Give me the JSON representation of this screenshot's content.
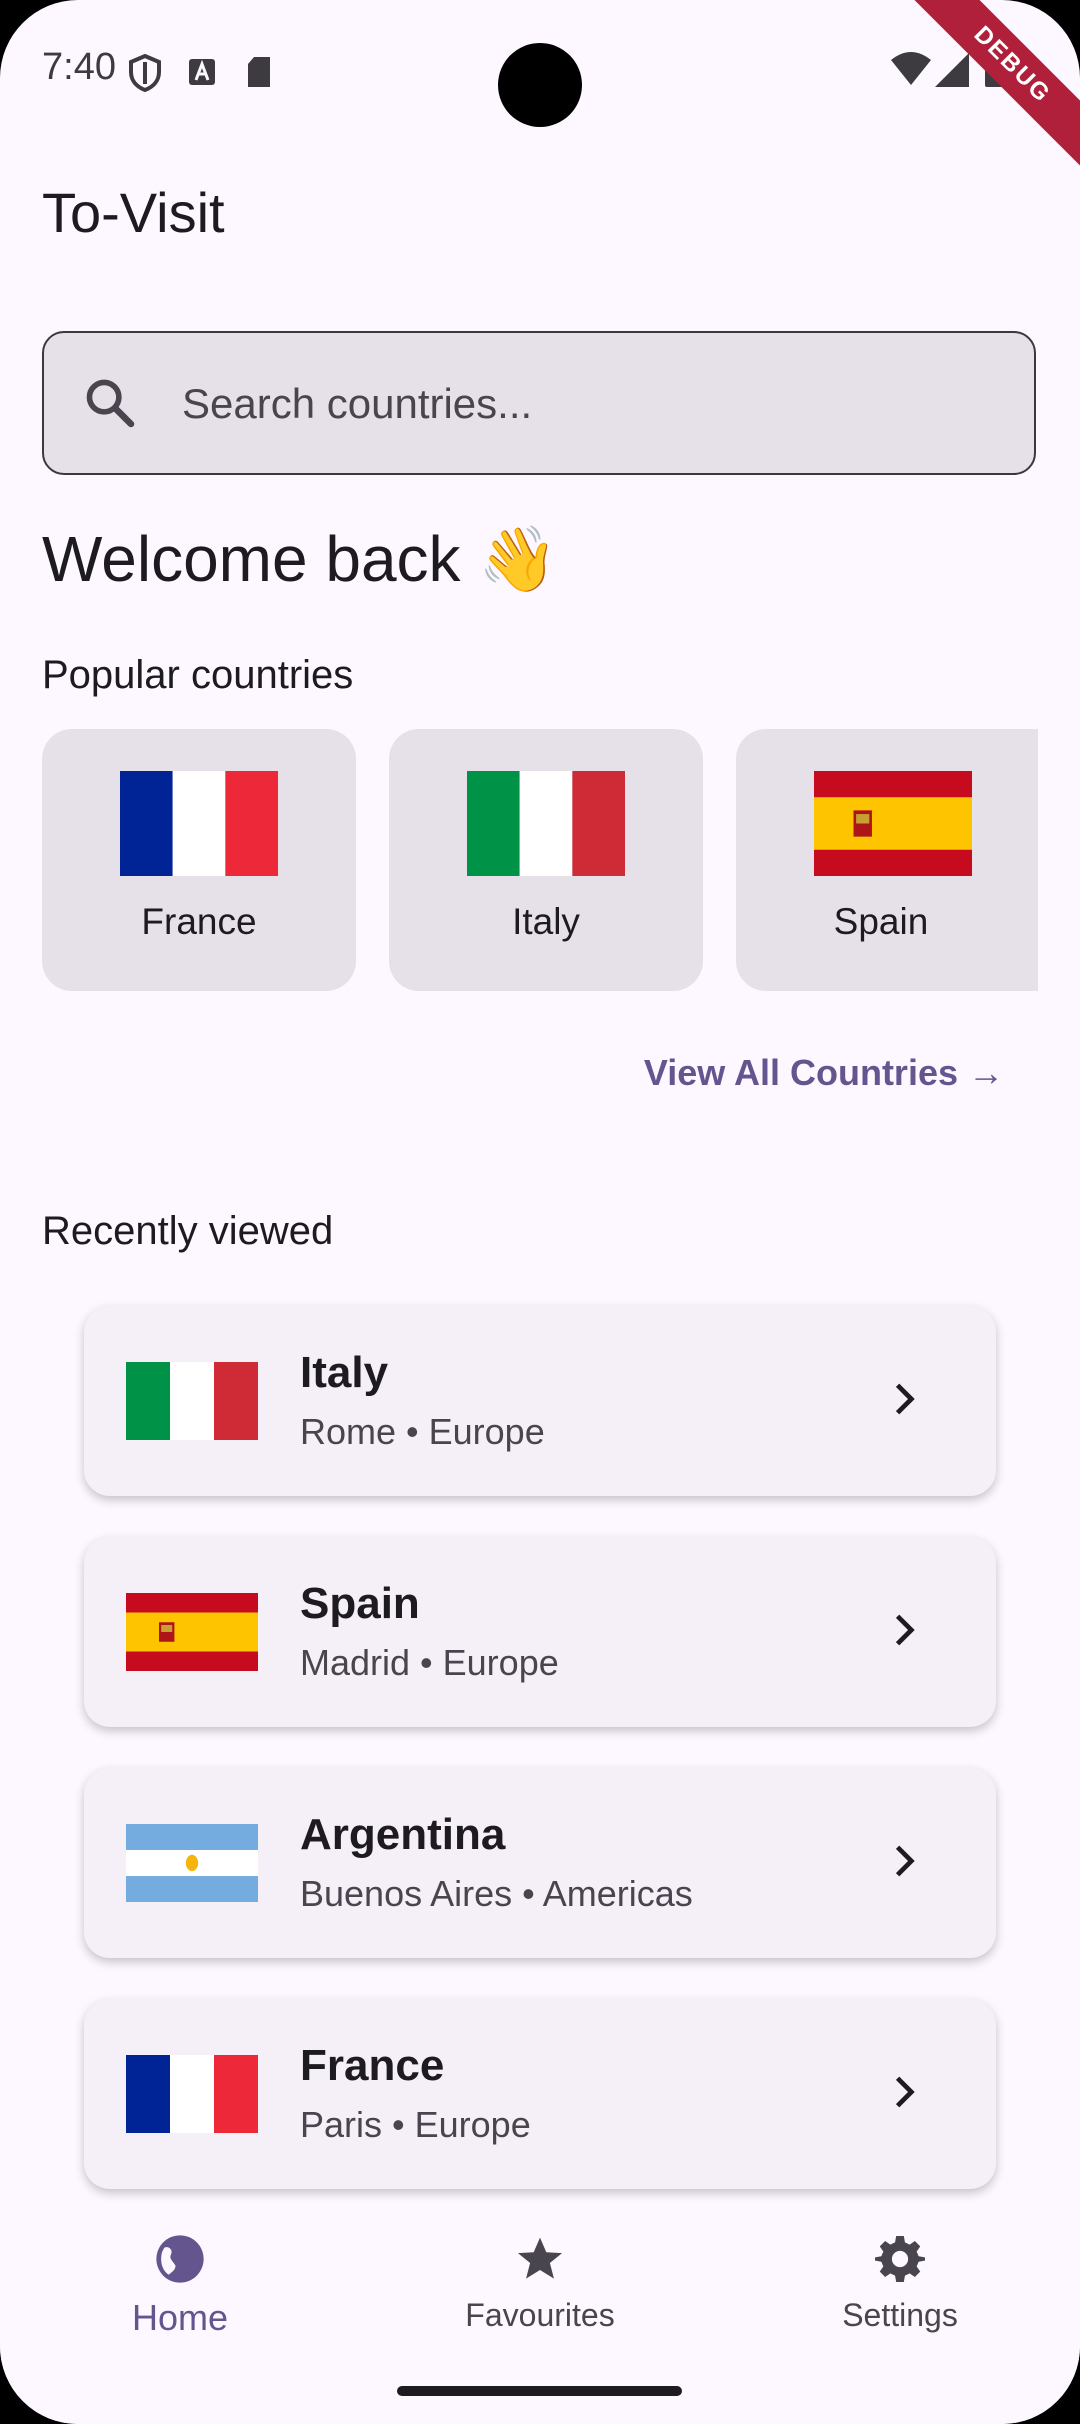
{
  "status_bar": {
    "time": "7:40",
    "debug_label": "DEBUG"
  },
  "app": {
    "title": "To-Visit"
  },
  "search": {
    "placeholder": "Search countries..."
  },
  "welcome": {
    "text": "Welcome back 👋"
  },
  "popular": {
    "title": "Popular countries",
    "items": [
      {
        "name": "France",
        "flag": "france-flag"
      },
      {
        "name": "Italy",
        "flag": "italy-flag"
      },
      {
        "name": "Spain",
        "flag": "spain-flag"
      }
    ],
    "view_all": "View All Countries →"
  },
  "recent": {
    "title": "Recently viewed",
    "items": [
      {
        "name": "Italy",
        "subtitle": "Rome • Europe",
        "flag": "italy-flag"
      },
      {
        "name": "Spain",
        "subtitle": "Madrid • Europe",
        "flag": "spain-flag"
      },
      {
        "name": "Argentina",
        "subtitle": "Buenos Aires • Americas",
        "flag": "argentina-flag"
      },
      {
        "name": "France",
        "subtitle": "Paris • Europe",
        "flag": "france-flag"
      }
    ]
  },
  "nav": {
    "items": [
      {
        "label": "Home",
        "icon": "globe-icon",
        "active": true
      },
      {
        "label": "Favourites",
        "icon": "star-icon",
        "active": false
      },
      {
        "label": "Settings",
        "icon": "gear-icon",
        "active": false
      }
    ]
  },
  "colors": {
    "accent": "#65558f",
    "background": "#fdf7ff",
    "card": "#e6e0e9"
  }
}
